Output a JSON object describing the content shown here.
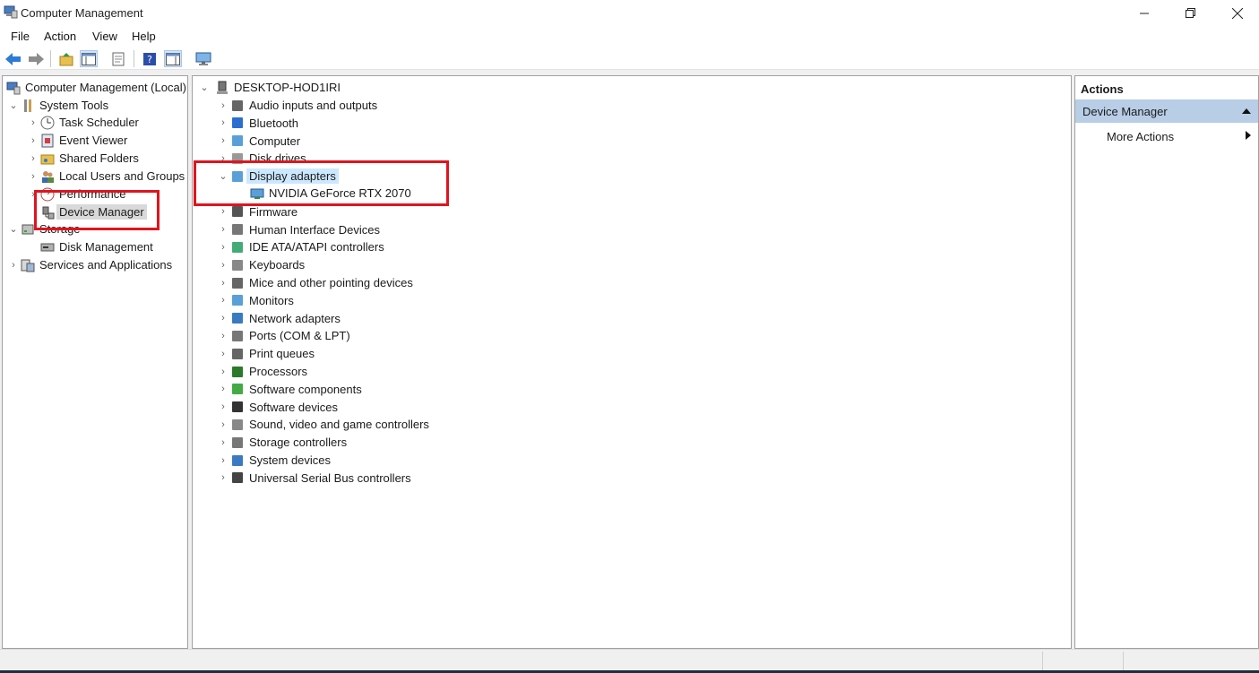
{
  "window": {
    "title": "Computer Management"
  },
  "menu": [
    "File",
    "Action",
    "View",
    "Help"
  ],
  "left_tree": [
    {
      "label": "Computer Management (Local)",
      "icon": "computer-management-icon"
    },
    {
      "label": "System Tools",
      "icon": "tools-icon"
    },
    {
      "label": "Task Scheduler",
      "icon": "clock-icon"
    },
    {
      "label": "Event Viewer",
      "icon": "event-viewer-icon"
    },
    {
      "label": "Shared Folders",
      "icon": "shared-folders-icon"
    },
    {
      "label": "Local Users and Groups",
      "icon": "users-icon"
    },
    {
      "label": "Performance",
      "icon": "performance-icon"
    },
    {
      "label": "Device Manager",
      "icon": "device-manager-icon"
    },
    {
      "label": "Storage",
      "icon": "storage-icon"
    },
    {
      "label": "Disk Management",
      "icon": "disk-management-icon"
    },
    {
      "label": "Services and Applications",
      "icon": "services-icon"
    }
  ],
  "device_tree": {
    "root": "DESKTOP-HOD1IRI",
    "categories": [
      "Audio inputs and outputs",
      "Bluetooth",
      "Computer",
      "Disk drives",
      "Display adapters",
      "Firmware",
      "Human Interface Devices",
      "IDE ATA/ATAPI controllers",
      "Keyboards",
      "Mice and other pointing devices",
      "Monitors",
      "Network adapters",
      "Ports (COM & LPT)",
      "Print queues",
      "Processors",
      "Software components",
      "Software devices",
      "Sound, video and game controllers",
      "Storage controllers",
      "System devices",
      "Universal Serial Bus controllers"
    ],
    "expanded_child": "NVIDIA GeForce RTX 2070"
  },
  "actions": {
    "header": "Actions",
    "section": "Device Manager",
    "more": "More Actions"
  },
  "colors": {
    "highlight": "#e0141e",
    "selection": "#cce8ff",
    "actions_section": "#b8cde6"
  }
}
